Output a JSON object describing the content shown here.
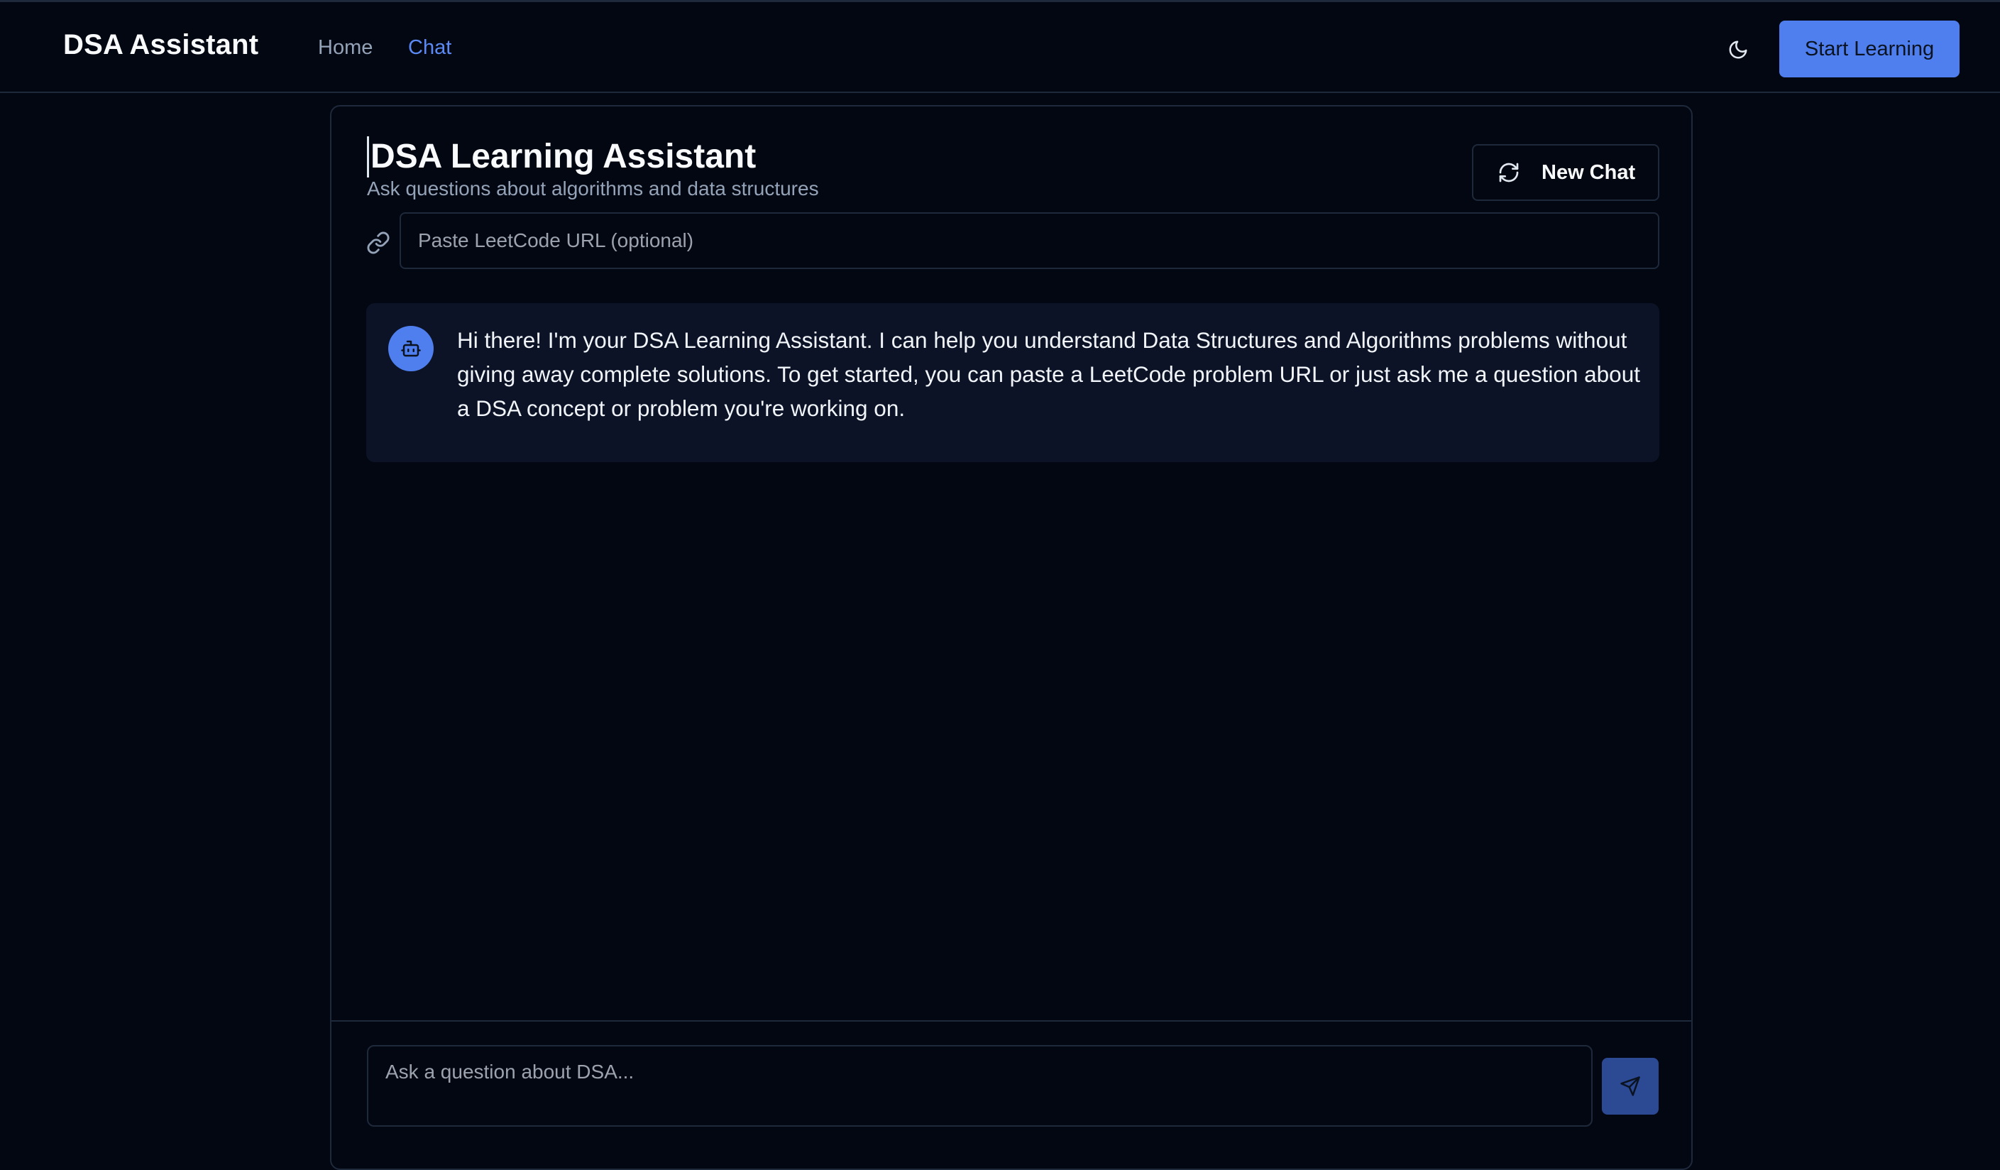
{
  "navbar": {
    "brand": "DSA Assistant",
    "links": [
      {
        "label": "Home",
        "active": false
      },
      {
        "label": "Chat",
        "active": true
      }
    ],
    "theme_toggle_icon": "moon-icon",
    "cta_label": "Start Learning"
  },
  "chat": {
    "title": "DSA Learning Assistant",
    "subtitle": "Ask questions about algorithms and data structures",
    "new_chat_label": "New Chat",
    "new_chat_icon": "refresh-icon",
    "url_input": {
      "placeholder": "Paste LeetCode URL (optional)",
      "value": "",
      "icon": "link-icon"
    },
    "messages": [
      {
        "role": "assistant",
        "avatar_icon": "bot-icon",
        "text": "Hi there! I'm your DSA Learning Assistant. I can help you understand Data Structures and Algorithms problems without giving away complete solutions. To get started, you can paste a LeetCode problem URL or just ask me a question about a DSA concept or problem you're working on."
      }
    ],
    "composer": {
      "placeholder": "Ask a question about DSA...",
      "value": "",
      "send_icon": "send-icon"
    }
  },
  "colors": {
    "background": "#030712",
    "accent": "#4f7fee",
    "border": "#1e293b",
    "muted_text": "#94a3b8",
    "bubble": "#0c1326"
  }
}
